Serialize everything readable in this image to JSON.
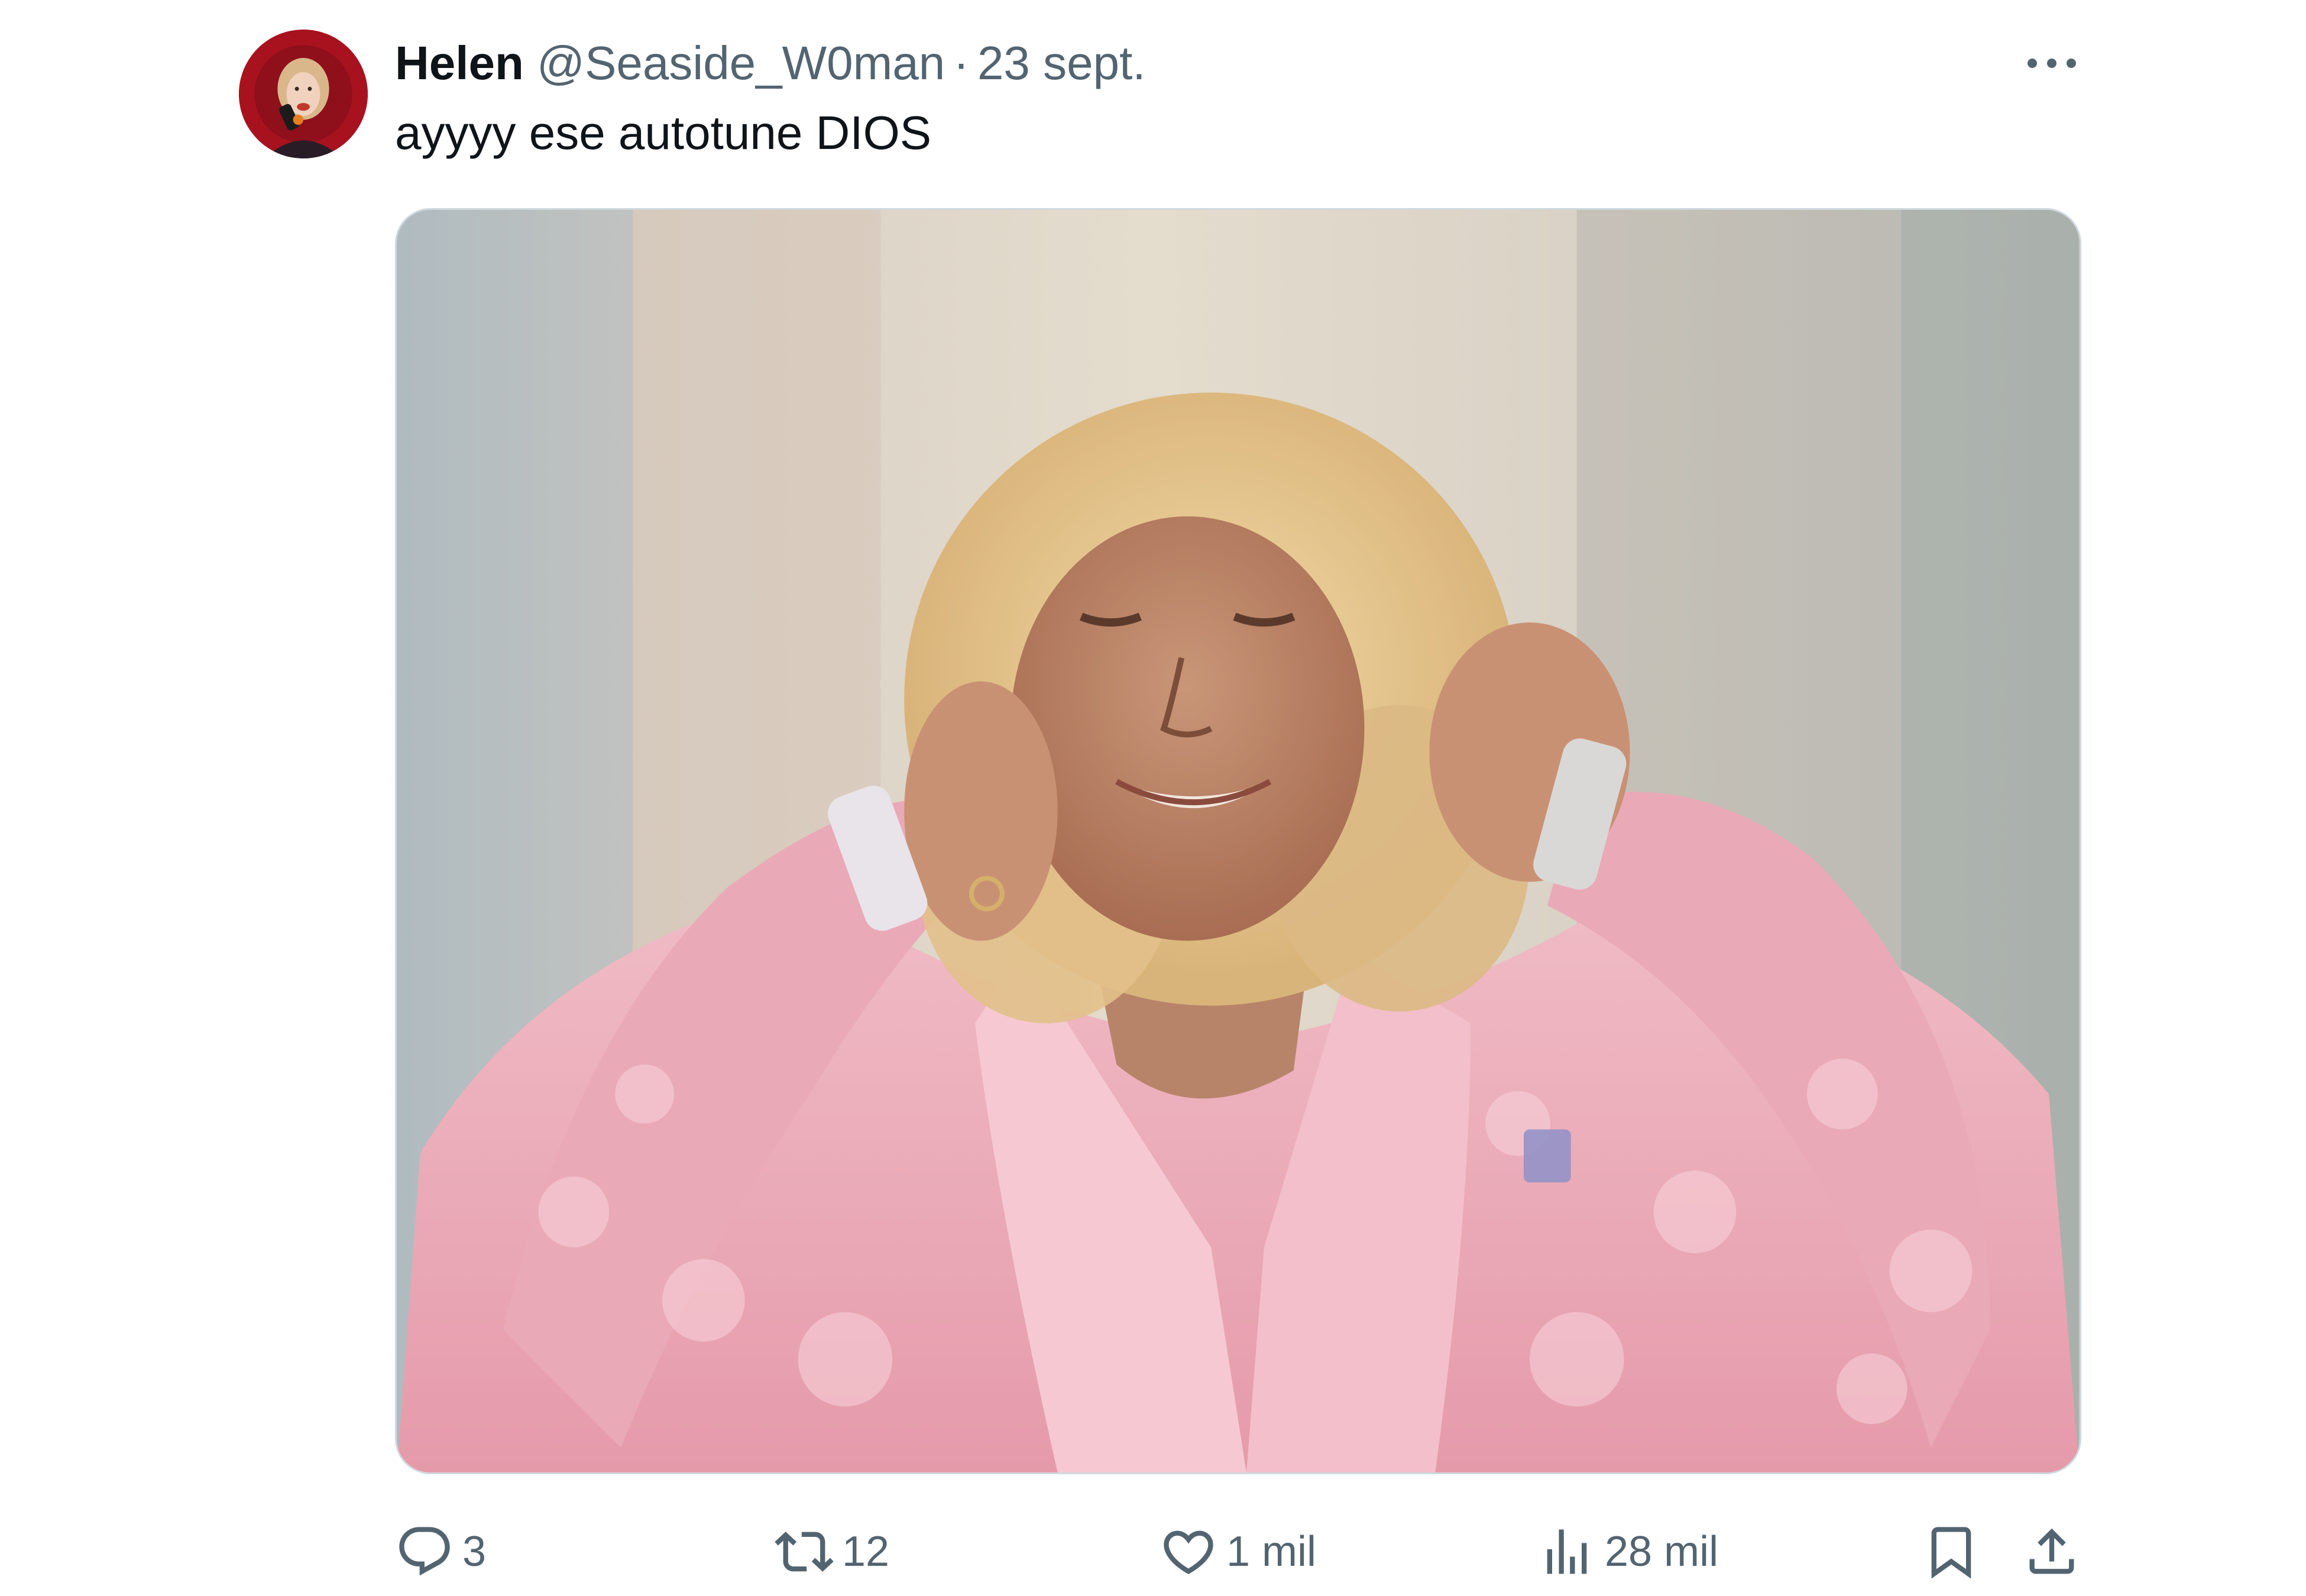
{
  "tweet": {
    "author": {
      "display_name": "Helen",
      "handle": "@Seaside_W0man"
    },
    "separator": "·",
    "date": "23 sept.",
    "text": "ayyyy ese autotune DIOS",
    "more_icon": "more-horizontal-icon",
    "media": {
      "kind": "photo",
      "description_color_theme": "pink"
    },
    "actions": {
      "reply": {
        "icon": "reply-icon",
        "count": "3"
      },
      "retweet": {
        "icon": "retweet-icon",
        "count": "12"
      },
      "like": {
        "icon": "heart-icon",
        "count": "1 mil"
      },
      "views": {
        "icon": "analytics-icon",
        "count": "28 mil"
      },
      "bookmark": {
        "icon": "bookmark-icon"
      },
      "share": {
        "icon": "share-icon"
      }
    }
  },
  "colors": {
    "text_primary": "#0f1419",
    "text_secondary": "#536471",
    "border": "#cfd9de"
  }
}
